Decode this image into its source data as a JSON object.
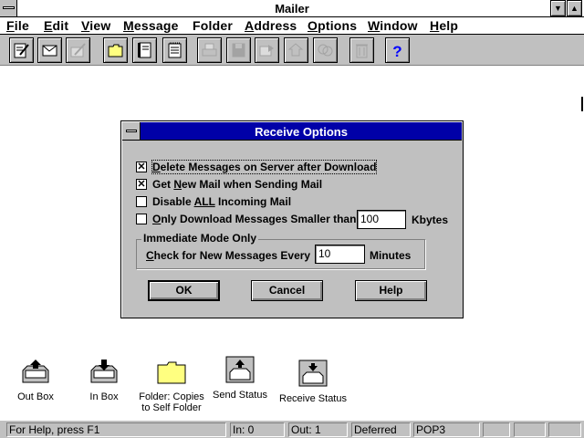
{
  "window": {
    "title": "Mailer"
  },
  "menu": [
    {
      "u": "F",
      "rest": "ile"
    },
    {
      "u": "E",
      "rest": "dit"
    },
    {
      "u": "V",
      "rest": "iew"
    },
    {
      "u": "M",
      "rest": "essage"
    },
    {
      "u": "",
      "rest": "Folder"
    },
    {
      "u": "A",
      "rest": "ddress"
    },
    {
      "u": "O",
      "rest": "ptions"
    },
    {
      "u": "W",
      "rest": "indow"
    },
    {
      "u": "H",
      "rest": "elp"
    }
  ],
  "toolbar": [
    {
      "icon": "compose-icon",
      "enabled": true
    },
    {
      "icon": "read-message-icon",
      "enabled": true
    },
    {
      "icon": "forward-icon",
      "enabled": false
    },
    {
      "icon": "folder-icon",
      "enabled": true
    },
    {
      "icon": "book-icon",
      "enabled": true
    },
    {
      "icon": "notepad-icon",
      "enabled": true
    },
    {
      "icon": "print-icon",
      "enabled": false
    },
    {
      "icon": "save-icon",
      "enabled": false
    },
    {
      "icon": "move-icon",
      "enabled": false
    },
    {
      "icon": "reply-icon",
      "enabled": false
    },
    {
      "icon": "reply-all-icon",
      "enabled": false
    },
    {
      "icon": "trash-icon",
      "enabled": false
    },
    {
      "icon": "help-icon",
      "enabled": true
    }
  ],
  "dialog": {
    "title": "Receive Options",
    "opt_delete": {
      "checked": true,
      "pre": "",
      "u": "D",
      "post": "elete Messages on Server after Download"
    },
    "opt_getnew": {
      "checked": true,
      "pre": "Get ",
      "u": "N",
      "post": "ew Mail when Sending Mail"
    },
    "opt_disable": {
      "checked": false,
      "pre": "Disable ",
      "u": "ALL",
      "post": " Incoming Mail"
    },
    "opt_only": {
      "checked": false,
      "pre": "",
      "u": "O",
      "post": "nly Download Messages Smaller than"
    },
    "size_value": "100",
    "size_unit": "Kbytes",
    "group_title": "Immediate Mode Only",
    "check_pre": "",
    "check_u": "C",
    "check_post": "heck for New Messages Every",
    "minutes_value": "10",
    "minutes_unit": "Minutes",
    "ok": "OK",
    "cancel": "Cancel",
    "help": "Help"
  },
  "desktop_icons": [
    {
      "label": "Out Box",
      "icon": "outbox-icon"
    },
    {
      "label": "In Box",
      "icon": "inbox-icon"
    },
    {
      "label": "Folder: Copies to Self Folder",
      "icon": "folder-icon"
    },
    {
      "label": "Send Status",
      "icon": "send-status-icon"
    },
    {
      "label": "Receive Status",
      "icon": "receive-status-icon"
    }
  ],
  "status": {
    "help": "For Help, press F1",
    "in": "In:  0",
    "out": "Out:  1",
    "mode": "Deferred",
    "protocol": "POP3"
  },
  "colors": {
    "dialog_title_bg": "#0000a8",
    "face": "#c0c0c0",
    "help_icon": "#0000ff",
    "folder": "#ffff80"
  }
}
